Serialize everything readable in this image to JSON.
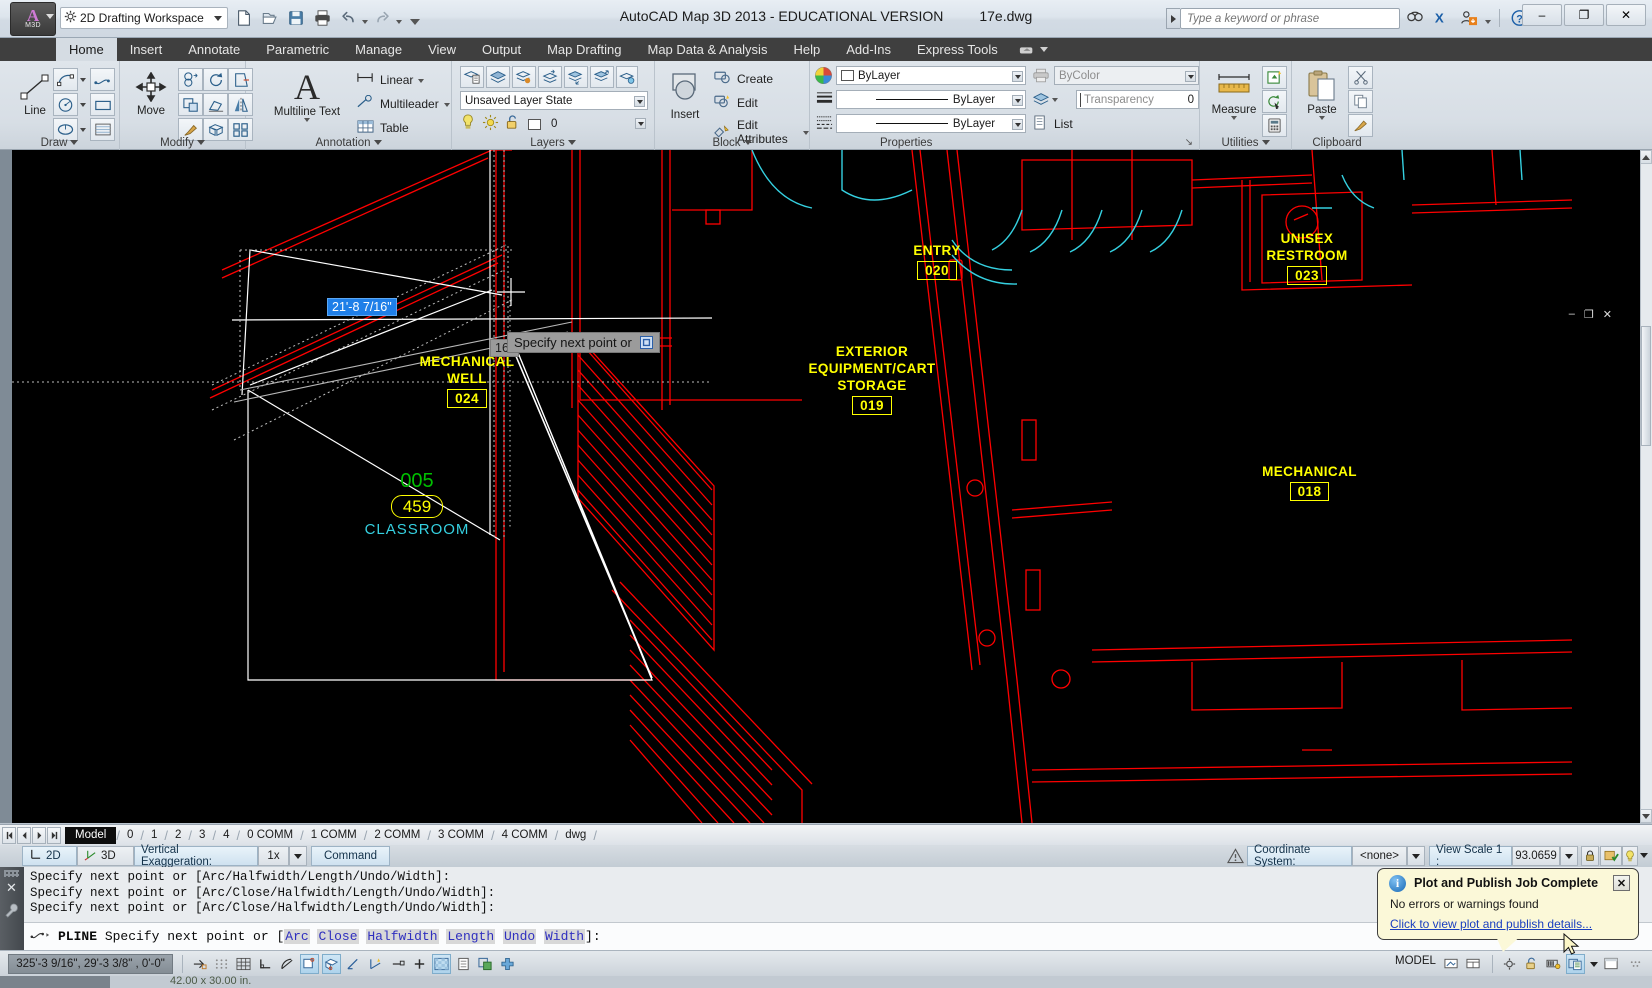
{
  "titlebar": {
    "workspace": "2D Drafting Workspace",
    "app_title": "AutoCAD Map 3D 2013 - EDUCATIONAL VERSION",
    "file_name": "17e.dwg",
    "search_placeholder": "Type a keyword or phrase",
    "qat": [
      {
        "name": "new-icon",
        "label": "New"
      },
      {
        "name": "open-icon",
        "label": "Open"
      },
      {
        "name": "save-icon",
        "label": "Save"
      },
      {
        "name": "plot-icon",
        "label": "Plot"
      },
      {
        "name": "undo-icon",
        "label": "Undo"
      },
      {
        "name": "redo-icon",
        "label": "Redo"
      }
    ],
    "window_controls": {
      "minimize": "–",
      "maximize": "❐",
      "close": "✕"
    }
  },
  "ribbon_tabs": [
    {
      "label": "Home",
      "active": true
    },
    {
      "label": "Insert",
      "active": false
    },
    {
      "label": "Annotate",
      "active": false
    },
    {
      "label": "Parametric",
      "active": false
    },
    {
      "label": "Manage",
      "active": false
    },
    {
      "label": "View",
      "active": false
    },
    {
      "label": "Output",
      "active": false
    },
    {
      "label": "Map Drafting",
      "active": false
    },
    {
      "label": "Map Data & Analysis",
      "active": false
    },
    {
      "label": "Help",
      "active": false
    },
    {
      "label": "Add-Ins",
      "active": false
    },
    {
      "label": "Express Tools",
      "active": false
    }
  ],
  "panels": {
    "draw": {
      "title": "Draw",
      "big_button": "Line"
    },
    "modify": {
      "title": "Modify",
      "big_button": "Move"
    },
    "annotation": {
      "title": "Annotation",
      "big_button": "Multiline Text",
      "items": [
        "Linear",
        "Multileader",
        "Table"
      ]
    },
    "layers": {
      "title": "Layers",
      "layer_state": "Unsaved Layer State",
      "current_layer": "0"
    },
    "block": {
      "title": "Block",
      "big_button": "Insert",
      "items": [
        "Create",
        "Edit",
        "Edit Attributes"
      ]
    },
    "properties": {
      "title": "Properties",
      "color": "ByLayer",
      "lineweight": "ByLayer",
      "linetype": "ByLayer",
      "plot_style": "ByColor",
      "transparency_label": "Transparency",
      "transparency_value": "0",
      "list_label": "List"
    },
    "utilities": {
      "title": "Utilities",
      "big_button": "Measure"
    },
    "clipboard": {
      "title": "Clipboard",
      "big_button": "Paste"
    }
  },
  "drawing": {
    "room_labels": [
      {
        "name": "mechanical-well",
        "line1": "MECHANICAL",
        "line2": "WELL",
        "number": "024"
      },
      {
        "name": "entry",
        "line1": "ENTRY",
        "line2": "",
        "number": "020"
      },
      {
        "name": "unisex-restroom",
        "line1": "UNISEX",
        "line2": "RESTROOM",
        "number": "023"
      },
      {
        "name": "exterior-storage",
        "line1": "EXTERIOR",
        "line2": "EQUIPMENT/CART",
        "line3": "STORAGE",
        "number": "019"
      },
      {
        "name": "mechanical",
        "line1": "MECHANICAL",
        "line2": "",
        "number": "018"
      }
    ],
    "classroom": {
      "number": "005",
      "area": "459",
      "label": "CLASSROOM"
    },
    "dynamic_input": {
      "distance": "21'-8 7/16\"",
      "angle": "16°"
    },
    "tooltip": "Specify next point or",
    "view_controls": [
      "–",
      "❐",
      "✕"
    ]
  },
  "layout_tabs": {
    "nav": [
      "⏮",
      "◀",
      "▶",
      "⏭"
    ],
    "tabs": [
      "Model",
      "0",
      "1",
      "2",
      "3",
      "4",
      "0 COMM",
      "1 COMM",
      "2 COMM",
      "3 COMM",
      "4 COMM",
      "dwg"
    ],
    "active": "Model"
  },
  "toolstrip": {
    "mode_2d": "2D",
    "mode_3d": "3D",
    "vertical_exaggeration_label": "Vertical Exaggeration:",
    "vertical_exaggeration_value": "1x",
    "command_label": "Command",
    "coordinate_system_label": "Coordinate System:",
    "coordinate_system_value": "<none>",
    "view_scale_label": "View Scale  1 :",
    "view_scale_value": "93.0659"
  },
  "command_window": {
    "history": [
      "Specify next point or [Arc/Halfwidth/Length/Undo/Width]:",
      "Specify next point or [Arc/Close/Halfwidth/Length/Undo/Width]:",
      "Specify next point or [Arc/Close/Halfwidth/Length/Undo/Width]:"
    ],
    "prompt_command": "PLINE",
    "prompt_text": "Specify next point or",
    "prompt_keywords": [
      "Arc",
      "Close",
      "Halfwidth",
      "Length",
      "Undo",
      "Width"
    ]
  },
  "statusbar": {
    "coordinates": "325'-3 9/16\", 29'-3 3/8\" , 0'-0\"",
    "model_label": "MODEL",
    "toggles": [
      {
        "name": "infer-constraints-toggle",
        "on": false
      },
      {
        "name": "snap-mode-toggle",
        "on": false
      },
      {
        "name": "grid-display-toggle",
        "on": false
      },
      {
        "name": "ortho-mode-toggle",
        "on": false
      },
      {
        "name": "polar-tracking-toggle",
        "on": false
      },
      {
        "name": "object-snap-toggle",
        "on": true
      },
      {
        "name": "3d-object-snap-toggle",
        "on": true
      },
      {
        "name": "object-snap-tracking-toggle",
        "on": false
      },
      {
        "name": "dynamic-ucs-toggle",
        "on": false
      },
      {
        "name": "dynamic-input-toggle",
        "on": false
      },
      {
        "name": "lineweight-toggle",
        "on": false
      },
      {
        "name": "transparency-toggle",
        "on": true
      },
      {
        "name": "quick-properties-toggle",
        "on": false
      },
      {
        "name": "selection-cycling-toggle",
        "on": false
      },
      {
        "name": "annotation-monitor-toggle",
        "on": false
      }
    ],
    "bottom_note": "42.00 x 30.00 in."
  },
  "notification": {
    "title": "Plot and Publish Job Complete",
    "subtitle": "No errors or warnings found",
    "link": "Click to view plot and publish details...",
    "close": "✕"
  },
  "colors": {
    "yellow": "#ffff00",
    "red": "#ff0000",
    "cyan": "#35d0e0",
    "green": "#00c000",
    "dyn_blue": "#1f7fe8",
    "canvas_bg": "#000000"
  }
}
